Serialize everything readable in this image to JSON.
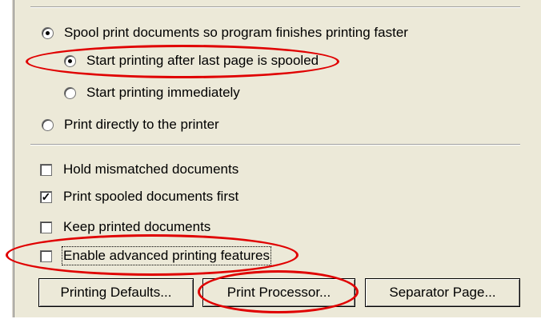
{
  "spooling": {
    "spool_option": "Spool print documents so program finishes printing faster",
    "after_last_page": "Start printing after last page is spooled",
    "immediately": "Start printing immediately",
    "direct": "Print directly to the printer"
  },
  "options": {
    "hold_mismatched": "Hold mismatched documents",
    "print_spooled_first": "Print spooled documents first",
    "keep_printed": "Keep printed documents",
    "enable_advanced": "Enable advanced printing features"
  },
  "buttons": {
    "printing_defaults": "Printing Defaults...",
    "print_processor": "Print Processor...",
    "separator_page": "Separator Page..."
  },
  "state": {
    "spool_selected": true,
    "after_last_page_selected": true,
    "immediately_selected": false,
    "direct_selected": false,
    "hold_mismatched_checked": false,
    "print_spooled_first_checked": true,
    "keep_printed_checked": false,
    "enable_advanced_checked": false
  },
  "colors": {
    "annotation": "#e00000",
    "dialog_background": "#ece9d8"
  }
}
